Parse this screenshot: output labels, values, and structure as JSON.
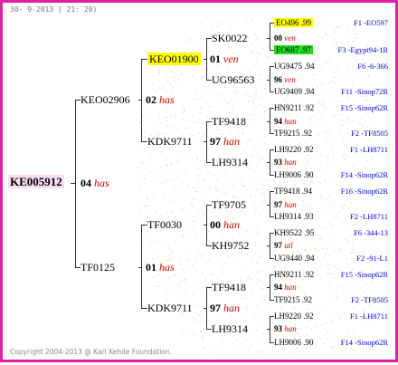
{
  "header": "30-  9-2013 ( 21: 20)",
  "footer": "Copyright 2004-2013 @ Karl Kehde Foundation.",
  "colors": {
    "border": "#e020a0",
    "rightText": "#0000cc",
    "subText": "#cc0000"
  },
  "root": {
    "id": "KE005912",
    "num": "04",
    "sub": "has"
  },
  "g1": [
    {
      "id": "KEO02906",
      "num": "02",
      "sub": "has"
    },
    {
      "id": "TF0125",
      "num": "01",
      "sub": "has"
    }
  ],
  "g2": [
    {
      "id": "KEO01900",
      "num": "01",
      "sub": "ven"
    },
    {
      "id": "KDK9711",
      "num": "97",
      "sub": "han"
    },
    {
      "id": "TF0030",
      "num": "00",
      "sub": "han"
    },
    {
      "id": "KDK9711",
      "num": "97",
      "sub": "han"
    }
  ],
  "g3": [
    {
      "id": "SK0022",
      "num": "00",
      "sub": "ven"
    },
    {
      "id": "UG96563",
      "num": "96",
      "sub": "ven"
    },
    {
      "id": "TF9418",
      "num": "94",
      "sub": "han"
    },
    {
      "id": "LH9314",
      "num": "93",
      "sub": "han"
    },
    {
      "id": "TF9705",
      "num": "97",
      "sub": "han"
    },
    {
      "id": "KH9752",
      "num": "97",
      "sub": "utl"
    },
    {
      "id": "TF9418",
      "num": "94",
      "sub": "han"
    },
    {
      "id": "LH9314",
      "num": "93",
      "sub": "han"
    }
  ],
  "g4": [
    {
      "id": "EO496",
      "sc": ".99",
      "right": "F1 -EO597",
      "hl": "yellow"
    },
    {
      "id": "EO687",
      "sc": ".97",
      "right": "F3 -Egypt94-1R",
      "hl": "green"
    },
    {
      "id": "UG9475",
      "sc": ".94",
      "right": "F6 -6-366"
    },
    {
      "id": "UG9409",
      "sc": ".94",
      "right": "F11 -Sinop72R"
    },
    {
      "id": "HN9211",
      "sc": ".92",
      "right": "F15 -Sinop62R"
    },
    {
      "id": "TF9215",
      "sc": ".92",
      "right": "F2 -TF8505"
    },
    {
      "id": "LH9220",
      "sc": ".92",
      "right": "F1 -LH8711"
    },
    {
      "id": "LH9006",
      "sc": ".90",
      "right": "F14 -Sinop62R"
    },
    {
      "id": "TF9418",
      "sc": ".94",
      "right": "F16 -Sinop62R"
    },
    {
      "id": "LH9314",
      "sc": ".93",
      "right": "F2 -LH8711"
    },
    {
      "id": "KH9522",
      "sc": ".95",
      "right": "F6 -344-13"
    },
    {
      "id": "UG9440",
      "sc": ".94",
      "right": "F2 -91-L1"
    },
    {
      "id": "HN9211",
      "sc": ".92",
      "right": "F15 -Sinop62R"
    },
    {
      "id": "TF9215",
      "sc": ".92",
      "right": "F2 -TF8505"
    },
    {
      "id": "LH9220",
      "sc": ".92",
      "right": "F1 -LH8711"
    },
    {
      "id": "LH9006",
      "sc": ".90",
      "right": "F14 -Sinop62R"
    }
  ]
}
